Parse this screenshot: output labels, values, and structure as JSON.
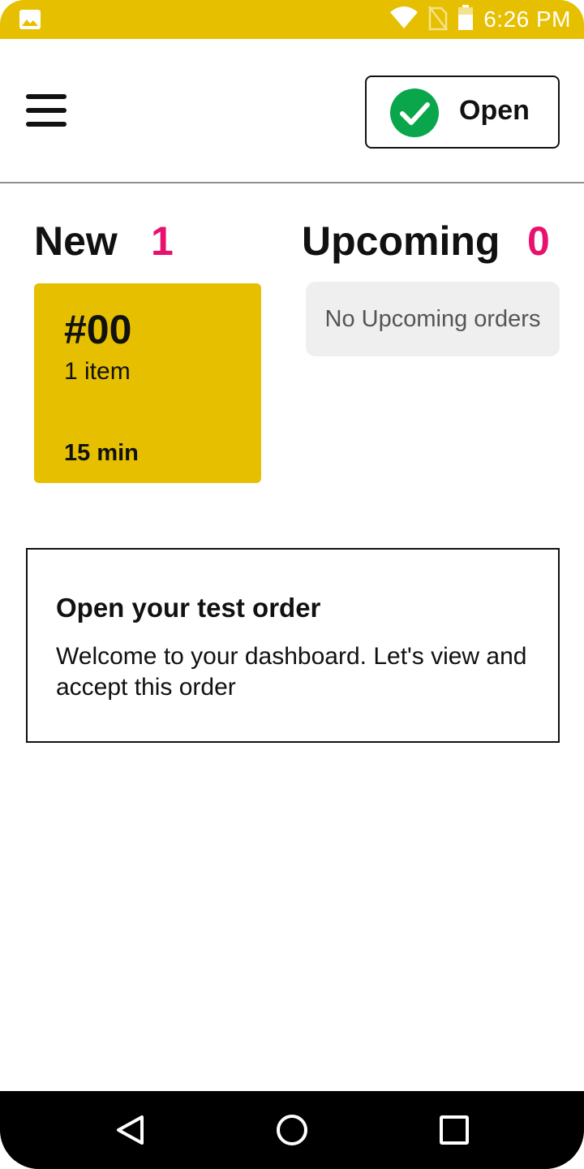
{
  "status_bar": {
    "time": "6:26 PM",
    "icons": [
      "image-icon",
      "wifi-icon",
      "no-sim-icon",
      "battery-icon"
    ]
  },
  "header": {
    "menu_icon": "menu-icon",
    "open_button": {
      "label": "Open",
      "icon": "check-circle-icon"
    }
  },
  "sections": {
    "new": {
      "title": "New",
      "count": "1"
    },
    "upcoming": {
      "title": "Upcoming",
      "count": "0",
      "empty_text": "No Upcoming orders"
    }
  },
  "orders": [
    {
      "number": "#00",
      "items": "1 item",
      "time": "15 min"
    }
  ],
  "onboarding": {
    "title": "Open your test order",
    "body": "Welcome to your dashboard. Let's view and accept this order"
  },
  "nav": {
    "icons": [
      "back-icon",
      "home-icon",
      "recents-icon"
    ]
  },
  "colors": {
    "brand": "#E6BF00",
    "count": "#E8126E",
    "check": "#0AA64B"
  }
}
